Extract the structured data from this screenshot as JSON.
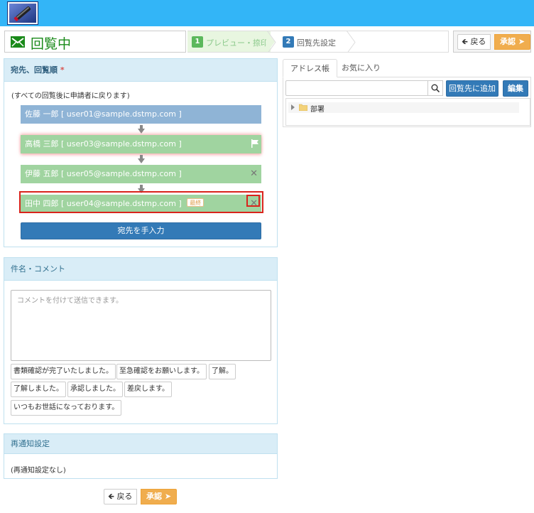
{
  "header": {
    "title": "回覧中",
    "steps": [
      {
        "number": "1",
        "label": "プレビュー・捺印"
      },
      {
        "number": "2",
        "label": "回覧先設定"
      }
    ],
    "back_label": "戻る",
    "approve_label": "承認"
  },
  "route_panel": {
    "title": "宛先、回覧順",
    "required_mark": "*",
    "hint": "(すべての回覧後に申請者に戻ります)",
    "recipients": [
      {
        "name": "佐藤 一郎 [ user01@sample.dstmp.com ]",
        "color": "#8fb4d6"
      },
      {
        "name": "高橋 三郎 [ user03@sample.dstmp.com ]",
        "color": "#a0d4a0"
      },
      {
        "name": "伊藤 五郎 [ user05@sample.dstmp.com ]",
        "color": "#a0d4a0"
      },
      {
        "name": "田中 四郎 [ user04@sample.dstmp.com ]",
        "color": "#a0d4a0",
        "badge": "最終"
      }
    ],
    "remove_glyph": "✕",
    "manual_input_label": "宛先を手入力"
  },
  "address_panel": {
    "tabs": [
      {
        "label": "アドレス帳",
        "active": true
      },
      {
        "label": "お気に入り",
        "active": false
      }
    ],
    "search_value": "",
    "add_label": "回覧先に追加",
    "edit_label": "編集",
    "tree": [
      {
        "label": "部署"
      }
    ]
  },
  "comment_panel": {
    "title": "件名・コメント",
    "placeholder": "コメントを付けて送信できます。",
    "phrases": [
      "書類確認が完了いたしました。",
      "至急確認をお願いします。",
      "了解。",
      "了解しました。",
      "承認しました。",
      "差戻します。",
      "いつもお世話になっております。"
    ]
  },
  "notice_panel": {
    "title": "再通知設定",
    "body": "(再通知設定なし)"
  },
  "footer": {
    "back_label": "戻る",
    "approve_label": "承認"
  },
  "colors": {
    "topbar": "#33b5f7",
    "primary": "#337ab7",
    "approve": "#f0ad4e",
    "title_green": "#1a8a1a",
    "highlight_red": "#d9241c"
  }
}
